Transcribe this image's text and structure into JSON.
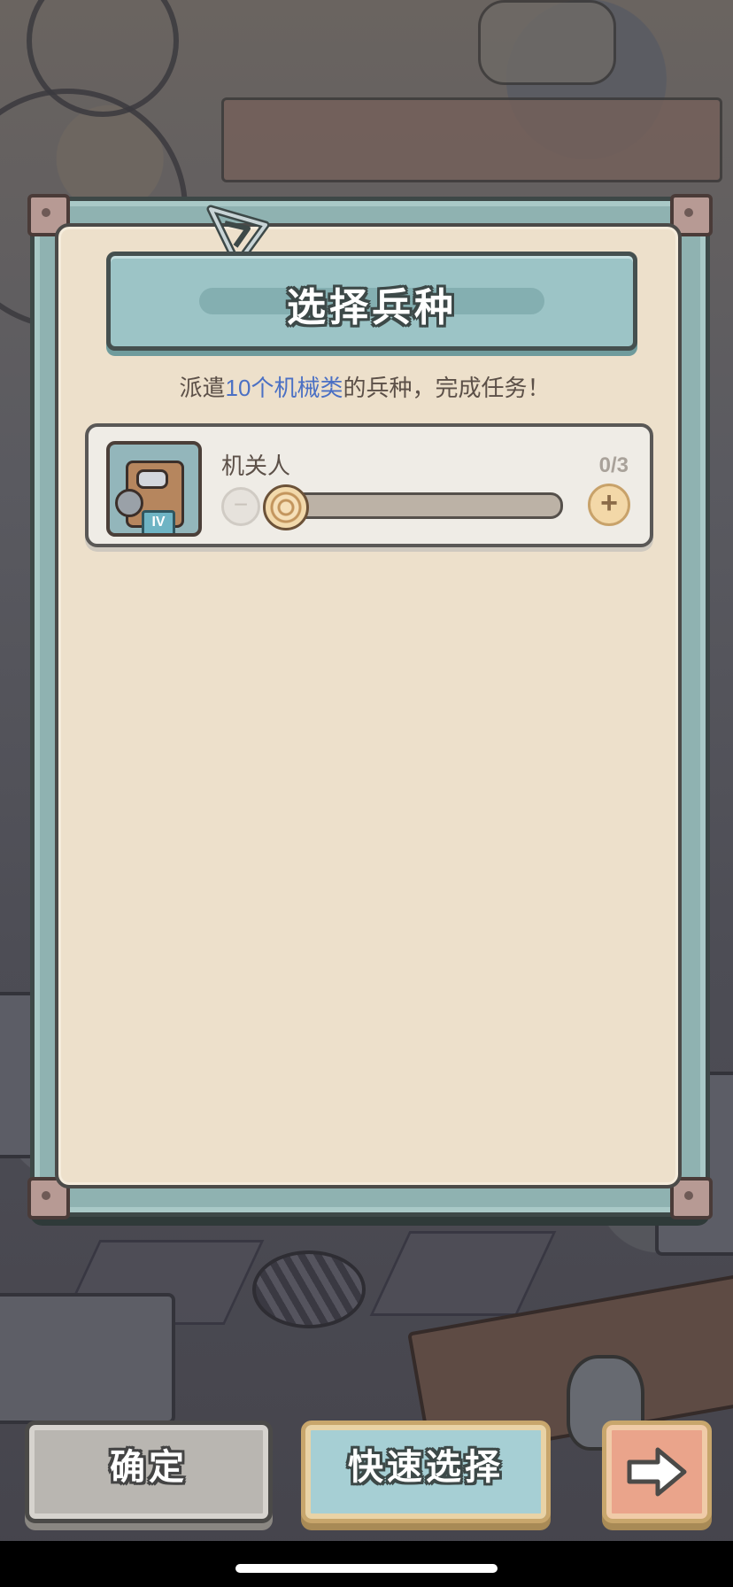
{
  "dialog": {
    "title": "选择兵种",
    "subtitle_prefix": "派遣",
    "subtitle_highlight": "10个机械类",
    "subtitle_suffix": "的兵种，完成任务！"
  },
  "unit": {
    "name": "机关人",
    "count": "0/3",
    "tier": "IV",
    "selected": 0,
    "max": 3,
    "minus_symbol": "−",
    "plus_symbol": "+"
  },
  "buttons": {
    "confirm_label": "确定",
    "quick_select_label": "快速选择",
    "next_icon": "arrow-right-icon"
  },
  "colors": {
    "highlight": "#4b70c4",
    "frame": "#8fb2b1",
    "paper": "#ede0cb"
  }
}
